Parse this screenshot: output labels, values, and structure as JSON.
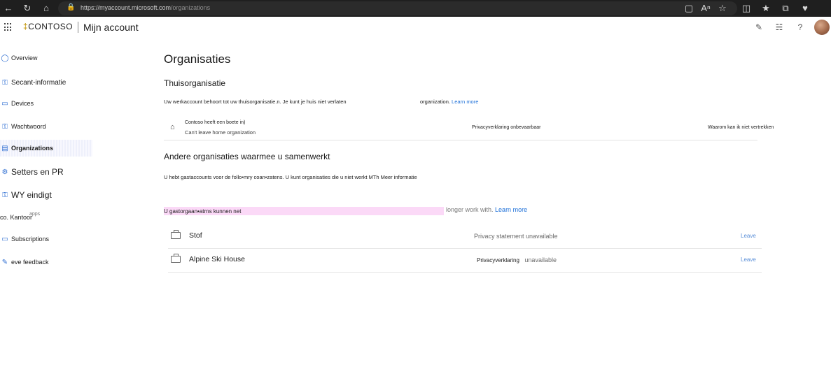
{
  "browser": {
    "url_host": "https://myaccount.microsoft.com",
    "url_path": "/organizations"
  },
  "header": {
    "logo": "CONTOSO",
    "title": "Mijn account"
  },
  "sidebar": {
    "items": [
      {
        "label": "Overview",
        "icon": "person-icon"
      },
      {
        "label": "Secant-informatie",
        "icon": "key-person-icon"
      },
      {
        "label": "Devices",
        "icon": "laptop-icon"
      },
      {
        "label": "Wachtwoord",
        "icon": "key-icon"
      },
      {
        "label": "Organizations",
        "icon": "briefcase-icon",
        "active": true
      },
      {
        "label": "Setters en PR",
        "icon": "gear-icon"
      },
      {
        "label": "WY eindigt",
        "icon": "key-person-icon"
      },
      {
        "label": "co. Kantoor",
        "overlap": "apps"
      },
      {
        "label": "Subscriptions",
        "icon": "card-icon"
      },
      {
        "label": "eve feedback",
        "icon": "feedback-icon"
      }
    ]
  },
  "main": {
    "title": "Organisaties",
    "home": {
      "heading": "Thuisorganisatie",
      "description": "Uw werkaccount behoort tot uw thuisorganisatie.n. Je kunt je huis niet verlaten",
      "description_tail": "organization.",
      "learn_more": "Learn more",
      "org_name": "Contoso heeft een boete in)",
      "org_sub": "Can't leave home organization",
      "privacy": "Privacyverklaring onbevaarbaar",
      "why": "Waarom kan ik niet vertrekken"
    },
    "other": {
      "heading": "Andere organisaties waarmee u samenwerkt",
      "description": "U hebt gastaccounts voor de follo•mry coan•zatens. U kunt organisaties die u niet werkt MTh Meer informatie",
      "highlight_text": "U gastorgaan•atrns kunnen net",
      "highlight_rest": "longer work with.",
      "learn_more": "Learn more",
      "orgs": [
        {
          "name": "Stof",
          "privacy": "Privacy statement unavailable",
          "privacy_prefix": "",
          "leave": "Leave"
        },
        {
          "name": "Alpine Ski House",
          "privacy_prefix": "Privacyverklaring",
          "privacy": "unavailable",
          "leave": "Leave"
        }
      ]
    }
  }
}
